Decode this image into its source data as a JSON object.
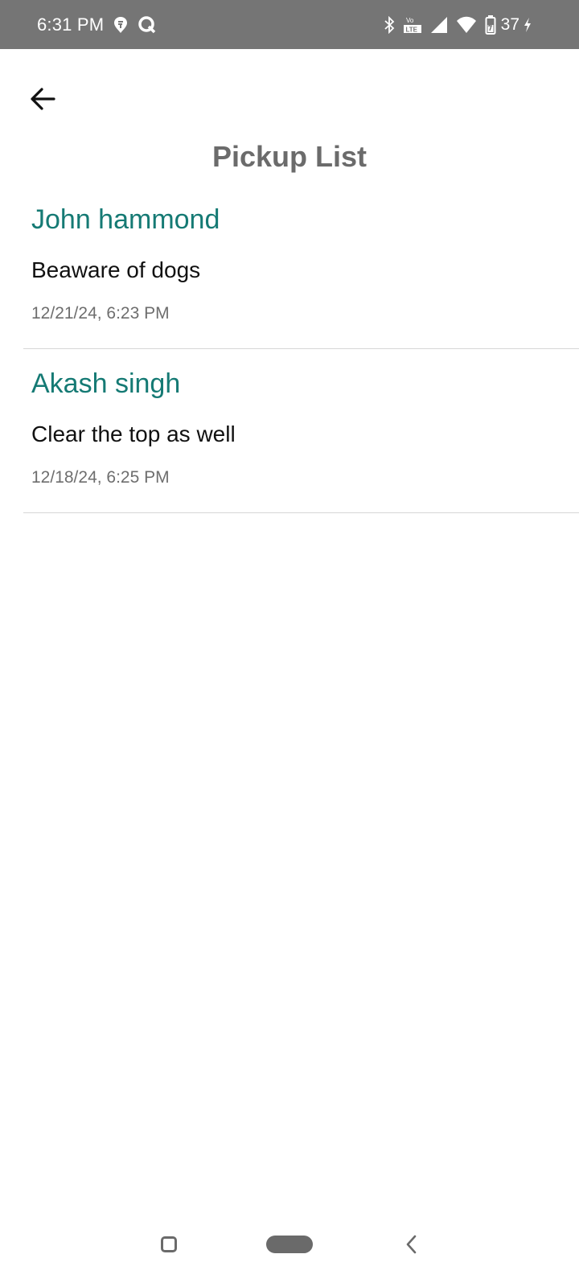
{
  "status_bar": {
    "time": "6:31 PM",
    "battery_level": "37",
    "icons": [
      "swiggy-notification-icon",
      "q-notification-icon",
      "bluetooth-icon",
      "volte-lte-icon",
      "cellular-signal-icon",
      "wifi-icon",
      "battery-icon",
      "charging-icon"
    ]
  },
  "header": {
    "title": "Pickup List",
    "back_icon": "arrow-left-icon"
  },
  "pickups": [
    {
      "name": "John hammond",
      "note": "Beaware of dogs",
      "datetime": "12/21/24, 6:23 PM"
    },
    {
      "name": "Akash singh",
      "note": "Clear the top as well",
      "datetime": "12/18/24, 6:25 PM"
    }
  ],
  "nav_bar": {
    "icons": [
      "recents-icon",
      "home-pill-icon",
      "back-chevron-icon"
    ]
  },
  "colors": {
    "status_bar_bg": "#757575",
    "title": "#6b6b6b",
    "name_accent": "#157a74",
    "divider": "#d6d6d6"
  }
}
